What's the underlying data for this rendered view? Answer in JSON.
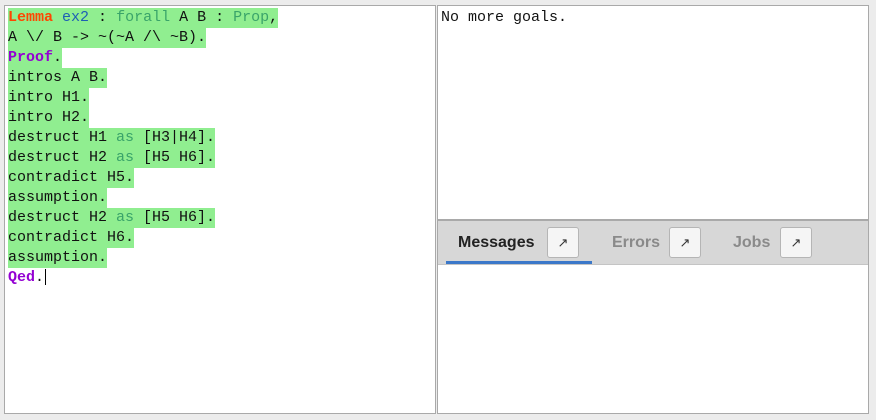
{
  "editor": {
    "lines": [
      {
        "tokens": [
          {
            "t": "Lemma",
            "c": "kw-orange"
          },
          {
            "t": " ",
            "c": "plain"
          },
          {
            "t": "ex2",
            "c": "kw-blue"
          },
          {
            "t": " : ",
            "c": "plain"
          },
          {
            "t": "forall",
            "c": "kw-green"
          },
          {
            "t": " A B : ",
            "c": "plain"
          },
          {
            "t": "Prop",
            "c": "kw-green"
          },
          {
            "t": ",",
            "c": "plain"
          }
        ]
      },
      {
        "tokens": [
          {
            "t": "A \\/ B -> ~(~A /\\ ~B).",
            "c": "plain"
          }
        ]
      },
      {
        "tokens": [
          {
            "t": "Proof",
            "c": "kw-purple"
          },
          {
            "t": ".",
            "c": "plain"
          }
        ]
      },
      {
        "tokens": [
          {
            "t": "intros A B.",
            "c": "plain"
          }
        ]
      },
      {
        "tokens": [
          {
            "t": "intro H1.",
            "c": "plain"
          }
        ]
      },
      {
        "tokens": [
          {
            "t": "intro H2.",
            "c": "plain"
          }
        ]
      },
      {
        "tokens": [
          {
            "t": "destruct H1 ",
            "c": "plain"
          },
          {
            "t": "as",
            "c": "kw-green"
          },
          {
            "t": " [H3|H4].",
            "c": "plain"
          }
        ]
      },
      {
        "tokens": [
          {
            "t": "destruct H2 ",
            "c": "plain"
          },
          {
            "t": "as",
            "c": "kw-green"
          },
          {
            "t": " [H5 H6].",
            "c": "plain"
          }
        ]
      },
      {
        "tokens": [
          {
            "t": "contradict H5.",
            "c": "plain"
          }
        ]
      },
      {
        "tokens": [
          {
            "t": "assumption.",
            "c": "plain"
          }
        ]
      },
      {
        "tokens": [
          {
            "t": "destruct H2 ",
            "c": "plain"
          },
          {
            "t": "as",
            "c": "kw-green"
          },
          {
            "t": " [H5 H6].",
            "c": "plain"
          }
        ]
      },
      {
        "tokens": [
          {
            "t": "contradict H6.",
            "c": "plain"
          }
        ]
      },
      {
        "tokens": [
          {
            "t": "assumption.",
            "c": "plain"
          }
        ]
      },
      {
        "tokens": [
          {
            "t": "Qed",
            "c": "kw-purple"
          },
          {
            "t": ".",
            "c": "plain"
          }
        ],
        "cursor": true,
        "unhighlighted": true
      }
    ]
  },
  "goals": {
    "text": "No more goals."
  },
  "tabs": [
    {
      "label": "Messages",
      "active": true,
      "icon": "↗"
    },
    {
      "label": "Errors",
      "active": false,
      "icon": "↗"
    },
    {
      "label": "Jobs",
      "active": false,
      "icon": "↗"
    }
  ],
  "colors": {
    "highlight": "#90ee90",
    "active_tab_text": "#222222",
    "inactive_tab_text": "#8a8a8a",
    "tab_underline": "#3b78c9"
  }
}
